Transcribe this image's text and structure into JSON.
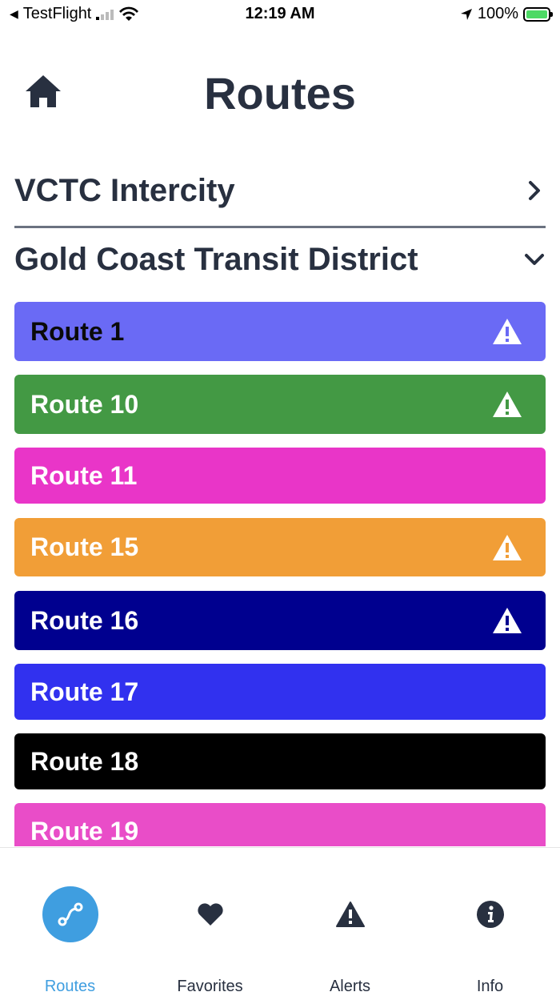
{
  "status_bar": {
    "back_app": "TestFlight",
    "time": "12:19 AM",
    "battery": "100%"
  },
  "header": {
    "title": "Routes",
    "home_icon": "home-icon"
  },
  "agencies": [
    {
      "name": "VCTC Intercity",
      "expanded": false
    },
    {
      "name": "Gold Coast Transit District",
      "expanded": true
    }
  ],
  "routes": [
    {
      "label": "Route 1",
      "bg": "#6a6af5",
      "fg": "#0a0a0a",
      "alert": true
    },
    {
      "label": "Route 10",
      "bg": "#439944",
      "fg": "#ffffff",
      "alert": true
    },
    {
      "label": "Route 11",
      "bg": "#e935c8",
      "fg": "#ffffff",
      "alert": false
    },
    {
      "label": "Route 15",
      "bg": "#f19e37",
      "fg": "#ffffff",
      "alert": true
    },
    {
      "label": "Route 16",
      "bg": "#00008f",
      "fg": "#ffffff",
      "alert": true
    },
    {
      "label": "Route 17",
      "bg": "#3131ef",
      "fg": "#ffffff",
      "alert": false
    },
    {
      "label": "Route 18",
      "bg": "#000000",
      "fg": "#ffffff",
      "alert": false
    },
    {
      "label": "Route 19",
      "bg": "#e94dc8",
      "fg": "#ffffff",
      "alert": false
    }
  ],
  "tabs": [
    {
      "label": "Routes",
      "icon": "route-icon",
      "active": true
    },
    {
      "label": "Favorites",
      "icon": "heart-icon",
      "active": false
    },
    {
      "label": "Alerts",
      "icon": "alert-icon",
      "active": false
    },
    {
      "label": "Info",
      "icon": "info-icon",
      "active": false
    }
  ],
  "colors": {
    "accent": "#3f9ee0",
    "text": "#283040"
  }
}
